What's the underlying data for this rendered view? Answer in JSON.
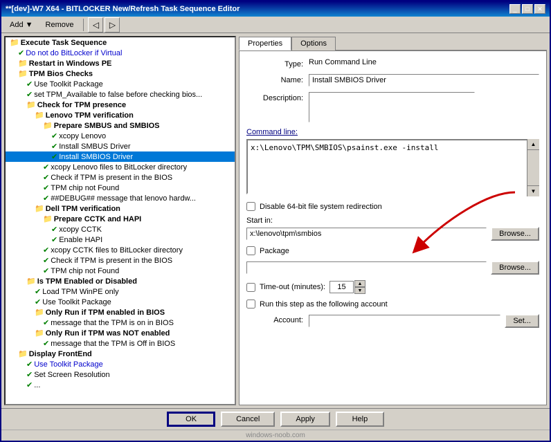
{
  "window": {
    "title": "**[dev]-W7 X64 - BITLOCKER New/Refresh Task Sequence Editor"
  },
  "menu": {
    "add": "Add ▼",
    "remove": "Remove"
  },
  "tree": {
    "items": [
      {
        "id": 1,
        "level": 0,
        "type": "folder",
        "label": "Execute Task Sequence",
        "bold": true
      },
      {
        "id": 2,
        "level": 1,
        "type": "check",
        "label": "Do not do BitLocker if Virtual",
        "color": "blue"
      },
      {
        "id": 3,
        "level": 1,
        "type": "folder",
        "label": "Restart in Windows PE",
        "bold": true
      },
      {
        "id": 4,
        "level": 1,
        "type": "folder",
        "label": "TPM Bios Checks",
        "bold": true
      },
      {
        "id": 5,
        "level": 2,
        "type": "check",
        "label": "Use Toolkit Package"
      },
      {
        "id": 6,
        "level": 2,
        "type": "check",
        "label": "set TPM_Available to false before checking bios..."
      },
      {
        "id": 7,
        "level": 2,
        "type": "folder",
        "label": "Check for TPM presence",
        "bold": true
      },
      {
        "id": 8,
        "level": 3,
        "type": "folder",
        "label": "Lenovo TPM verification",
        "bold": true
      },
      {
        "id": 9,
        "level": 4,
        "type": "folder",
        "label": "Prepare SMBUS and SMBIOS",
        "bold": true
      },
      {
        "id": 10,
        "level": 5,
        "type": "check",
        "label": "xcopy Lenovo"
      },
      {
        "id": 11,
        "level": 5,
        "type": "check",
        "label": "Install SMBUS Driver"
      },
      {
        "id": 12,
        "level": 5,
        "type": "check",
        "label": "Install SMBIOS Driver",
        "selected": true
      },
      {
        "id": 13,
        "level": 4,
        "type": "check",
        "label": "xcopy Lenovo files to BitLocker directory"
      },
      {
        "id": 14,
        "level": 4,
        "type": "check",
        "label": "Check if TPM is present in the BIOS"
      },
      {
        "id": 15,
        "level": 4,
        "type": "check",
        "label": "TPM chip not Found"
      },
      {
        "id": 16,
        "level": 4,
        "type": "check",
        "label": "##DEBUG## message that lenovo hardw..."
      },
      {
        "id": 17,
        "level": 3,
        "type": "folder",
        "label": "Dell TPM verification",
        "bold": true
      },
      {
        "id": 18,
        "level": 4,
        "type": "folder",
        "label": "Prepare CCTK and HAPI",
        "bold": true
      },
      {
        "id": 19,
        "level": 5,
        "type": "check",
        "label": "xcopy CCTK"
      },
      {
        "id": 20,
        "level": 5,
        "type": "check",
        "label": "Enable HAPI"
      },
      {
        "id": 21,
        "level": 4,
        "type": "check",
        "label": "xcopy CCTK files to BitLocker directory"
      },
      {
        "id": 22,
        "level": 4,
        "type": "check",
        "label": "Check if TPM is present in the BIOS"
      },
      {
        "id": 23,
        "level": 4,
        "type": "check",
        "label": "TPM chip not Found"
      },
      {
        "id": 24,
        "level": 2,
        "type": "folder",
        "label": "Is TPM Enabled or Disabled",
        "bold": true
      },
      {
        "id": 25,
        "level": 3,
        "type": "check",
        "label": "Load TPM WinPE only"
      },
      {
        "id": 26,
        "level": 3,
        "type": "check",
        "label": "Use Toolkit Package"
      },
      {
        "id": 27,
        "level": 3,
        "type": "folder",
        "label": "Only Run if TPM enabled in BIOS",
        "bold": true
      },
      {
        "id": 28,
        "level": 4,
        "type": "check",
        "label": "message that the  TPM is on in BIOS"
      },
      {
        "id": 29,
        "level": 3,
        "type": "folder",
        "label": "Only Run if TPM was NOT enabled",
        "bold": true
      },
      {
        "id": 30,
        "level": 4,
        "type": "check",
        "label": "message that the  TPM is Off in BIOS"
      },
      {
        "id": 31,
        "level": 1,
        "type": "folder",
        "label": "Display FrontEnd",
        "bold": true
      },
      {
        "id": 32,
        "level": 2,
        "type": "check",
        "label": "Use Toolkit Package",
        "color": "blue"
      },
      {
        "id": 33,
        "level": 2,
        "type": "check",
        "label": "Set Screen Resolution"
      },
      {
        "id": 34,
        "level": 2,
        "type": "check",
        "label": "..."
      }
    ]
  },
  "properties": {
    "tab_properties": "Properties",
    "tab_options": "Options",
    "type_label": "Type:",
    "type_value": "Run Command Line",
    "name_label": "Name:",
    "name_value": "Install SMBIOS Driver",
    "desc_label": "Description:",
    "desc_value": "",
    "cmdline_label": "Command line:",
    "cmdline_value": "x:\\Lenovo\\TPM\\SMBIOS\\psainst.exe -install",
    "disable64_label": "Disable 64-bit file system redirection",
    "startin_label": "Start in:",
    "startin_value": "x:\\lenovo\\tpm\\smbios",
    "browse_label": "Browse...",
    "package_label": "Package",
    "package_browse": "Browse...",
    "timeout_label": "Time-out (minutes):",
    "timeout_value": "15",
    "runaccount_label": "Run this step as the following account",
    "account_label": "Account:",
    "account_value": "",
    "set_label": "Set..."
  },
  "buttons": {
    "ok": "OK",
    "cancel": "Cancel",
    "apply": "Apply",
    "help": "Help"
  },
  "watermark": "windows-noob.com"
}
